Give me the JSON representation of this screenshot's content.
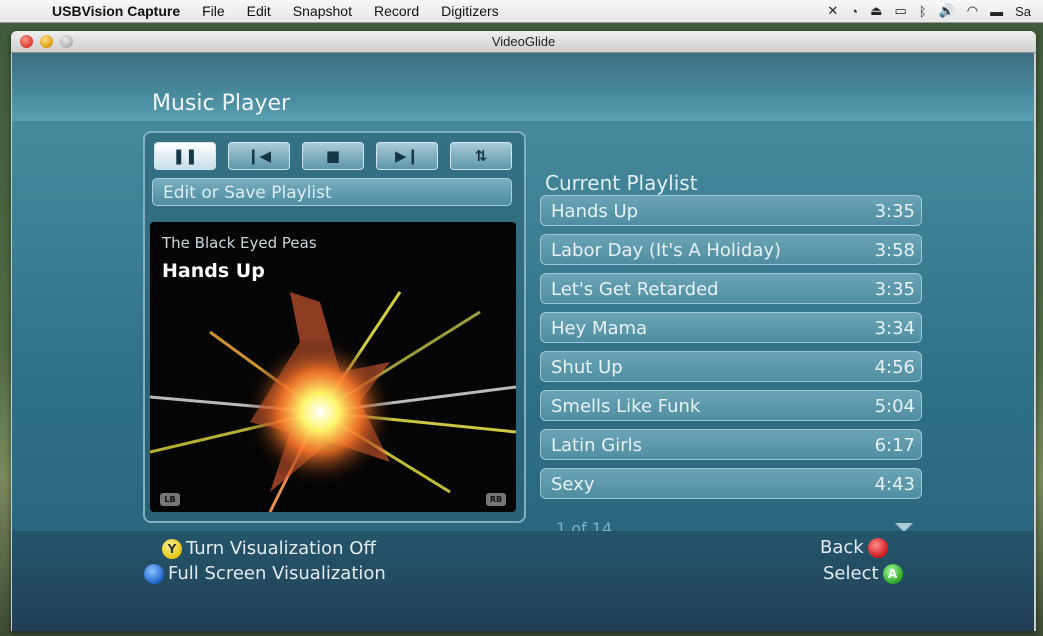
{
  "menubar": {
    "app_name": "USBVision Capture",
    "items": [
      "File",
      "Edit",
      "Snapshot",
      "Record",
      "Digitizers"
    ],
    "user": "Sa"
  },
  "window": {
    "title": "VideoGlide"
  },
  "player": {
    "title": "Music Player",
    "edit_button": "Edit or Save Playlist",
    "now_playing": {
      "artist": "The Black Eyed Peas",
      "track": "Hands Up"
    },
    "controls": [
      "pause",
      "previous",
      "stop",
      "next",
      "shuffle"
    ],
    "art_badges": {
      "left": "LB",
      "right": "RB"
    }
  },
  "playlist": {
    "title": "Current Playlist",
    "tracks": [
      {
        "name": "Hands Up",
        "duration": "3:35"
      },
      {
        "name": "Labor Day (It's A Holiday)",
        "duration": "3:58"
      },
      {
        "name": "Let's Get Retarded",
        "duration": "3:35"
      },
      {
        "name": "Hey Mama",
        "duration": "3:34"
      },
      {
        "name": "Shut Up",
        "duration": "4:56"
      },
      {
        "name": "Smells Like Funk",
        "duration": "5:04"
      },
      {
        "name": "Latin Girls",
        "duration": "6:17"
      },
      {
        "name": "Sexy",
        "duration": "4:43"
      }
    ],
    "page_count": "1 of 14"
  },
  "footer": {
    "y_hint": "Turn Visualization Off",
    "x_hint": "Full Screen Visualization",
    "back": "Back",
    "select": "Select",
    "y_label": "Y",
    "a_label": "A"
  }
}
